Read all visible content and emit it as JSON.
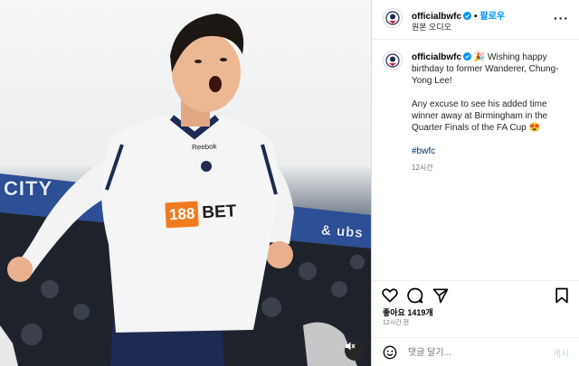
{
  "media": {
    "sign_left": "CITY",
    "sign_right": "& ubs",
    "shirt_brand": "Reebok",
    "sponsor_number": "188",
    "sponsor_word": "BET",
    "mute_icon": "speaker-muted-icon"
  },
  "header": {
    "username": "officialbwfc",
    "dot": "•",
    "follow_label": "팔로우",
    "audio_label": "원본 오디오",
    "more_label": "···"
  },
  "caption": {
    "username": "officialbwfc",
    "emoji_party": "🎉",
    "line1": "Wishing happy birthday to former Wanderer, Chung-Yong Lee!",
    "line2": "Any excuse to see his added time winner away at Birmingham in the Quarter Finals of the FA Cup",
    "emoji_heart_eyes": "😍",
    "hashtag": "#bwfc",
    "time": "12시간"
  },
  "actions": {
    "likes_label": "좋아요 1419개",
    "time_ago": "12시간 전"
  },
  "comment": {
    "placeholder": "댓글 달기...",
    "post_label": "게시"
  },
  "colors": {
    "accent": "#0095f6",
    "badge": "#0095f6",
    "sponsor_orange": "#f07b1f"
  }
}
